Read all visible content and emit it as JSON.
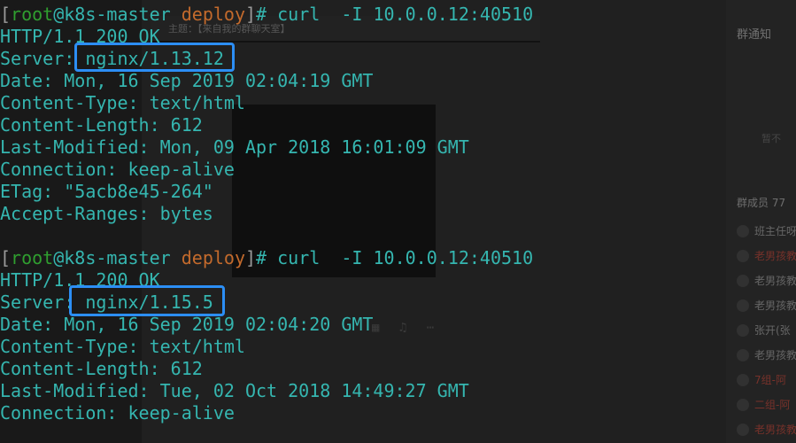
{
  "background": {
    "top_bar_text": "主题：【来自我的群聊天室】",
    "sidebar": {
      "notice_title": "群通知",
      "faint_text": "暂不",
      "members_header": "群成员 77",
      "members": [
        {
          "name": "班主任呀",
          "color": "grey"
        },
        {
          "name": "老男孩教",
          "color": "red"
        },
        {
          "name": "老男孩教",
          "color": "grey"
        },
        {
          "name": "老男孩教",
          "color": "grey"
        },
        {
          "name": "张开(张",
          "color": "grey"
        },
        {
          "name": "老男孩教",
          "color": "grey"
        },
        {
          "name": "7组-阿",
          "color": "red"
        },
        {
          "name": "二组-阿",
          "color": "red"
        },
        {
          "name": "老男孩教",
          "color": "red"
        }
      ]
    }
  },
  "terminal": {
    "block1": {
      "prompt": {
        "user": "root",
        "host": "k8s-master",
        "dir": "deploy",
        "command": "curl  -I 10.0.0.12:40510"
      },
      "lines": [
        "HTTP/1.1 200 OK",
        "Server: nginx/1.13.12",
        "Date: Mon, 16 Sep 2019 02:04:19 GMT",
        "Content-Type: text/html",
        "Content-Length: 612",
        "Last-Modified: Mon, 09 Apr 2018 16:01:09 GMT",
        "Connection: keep-alive",
        "ETag: \"5acb8e45-264\"",
        "Accept-Ranges: bytes"
      ]
    },
    "block2": {
      "prompt": {
        "user": "root",
        "host": "k8s-master",
        "dir": "deploy",
        "command": "curl  -I 10.0.0.12:40510"
      },
      "lines": [
        "HTTP/1.1 200 OK",
        "Server: nginx/1.15.5",
        "Date: Mon, 16 Sep 2019 02:04:20 GMT",
        "Content-Type: text/html",
        "Content-Length: 612",
        "Last-Modified: Tue, 02 Oct 2018 14:49:27 GMT",
        "Connection: keep-alive"
      ]
    }
  },
  "colors": {
    "terminal_text": "#35b6b0",
    "prompt_user": "#2f9e2f",
    "prompt_dir": "#c36a2c",
    "highlight_box": "#2c8ef5"
  }
}
